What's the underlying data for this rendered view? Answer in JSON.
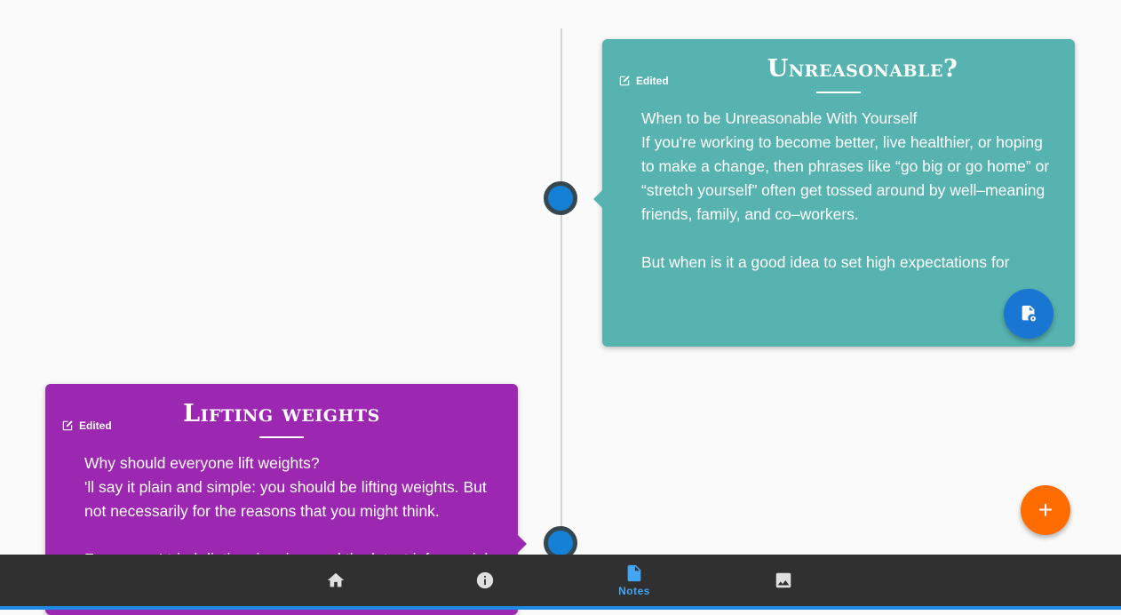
{
  "notes": [
    {
      "title": "Unreasonable?",
      "edited_label": "Edited",
      "body": "When to be Unreasonable With Yourself\nIf you're working to become better, live healthier, or hoping to make a change, then phrases like “go big or go home” or “stretch yourself” often get tossed around by well–meaning friends, family, and co–workers.\n\nBut when is it a good idea to set high expectations for",
      "color": "#57b3b0"
    },
    {
      "title": "Lifting weights",
      "edited_label": "Edited",
      "body": "Why should everyone lift weights?\n'll say it plain and simple: you should be lifting weights. But not necessarily for the reasons that you might think.\n\nFor years, I tried dieting, jogging, and the latest infomercial fads",
      "color": "#9c27b0"
    }
  ],
  "icons": {
    "edit": "edit-icon",
    "note_settings": "note-settings-icon",
    "add": "add-icon",
    "home": "home-icon",
    "info": "info-icon",
    "notes": "note-icon",
    "image": "image-icon"
  },
  "fab": {
    "add_symbol": "+"
  },
  "bottom_nav": {
    "active": "notes",
    "notes_label": "Notes"
  },
  "colors": {
    "accent": "#1e88e5",
    "fab_add": "#ff6d00",
    "timeline_dot": "#1480d6"
  }
}
